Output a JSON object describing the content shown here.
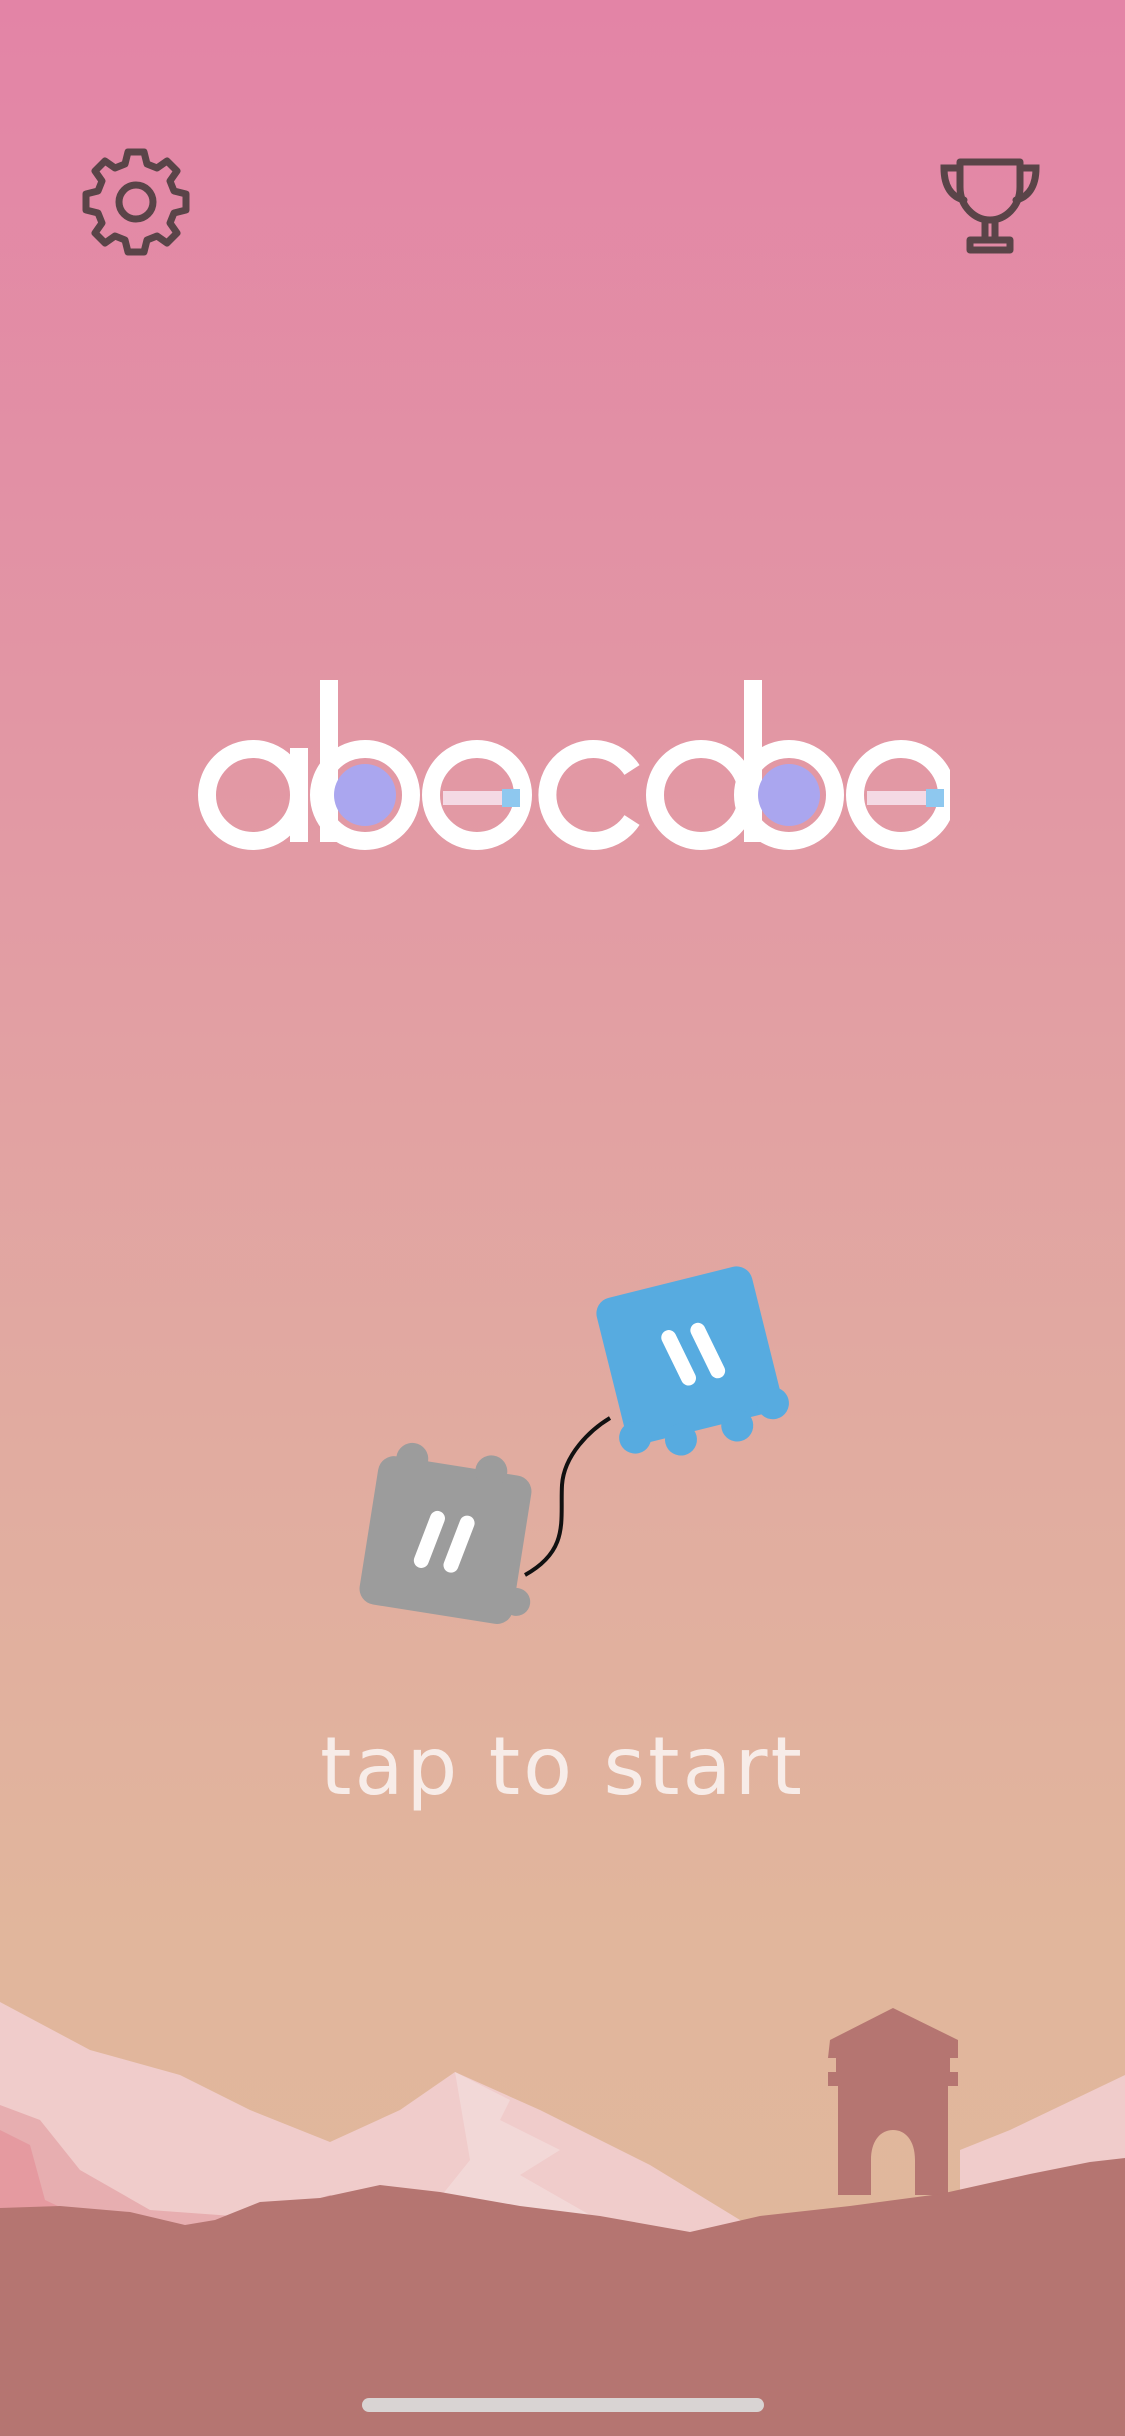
{
  "app": {
    "title": "abecobe"
  },
  "toolbar": {
    "settings_icon": "gear-icon",
    "trophy_icon": "trophy-icon"
  },
  "start_prompt": "tap to start",
  "colors": {
    "background_top": "#e384a6",
    "background_bottom": "#e0b89b",
    "logo_letters": "#ffffff",
    "logo_dot": "#aaa6ef",
    "cube_blue": "#57abe0",
    "cube_gray": "#9c9c9c",
    "ground": "#b57571",
    "icon_stroke": "#5a4448"
  }
}
